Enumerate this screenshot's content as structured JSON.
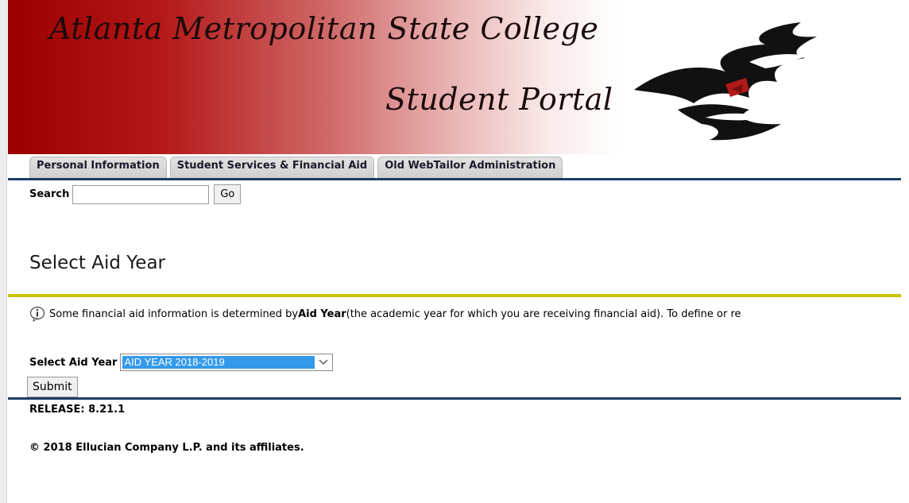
{
  "banner": {
    "title": "Atlanta Metropolitan State College",
    "subtitle": "Student Portal",
    "logo_icon": "trailblazer-logo-icon"
  },
  "tabs": [
    {
      "label": "Personal Information"
    },
    {
      "label": "Student Services & Financial Aid"
    },
    {
      "label": "Old WebTailor Administration"
    }
  ],
  "search": {
    "label": "Search",
    "value": "",
    "go_label": "Go"
  },
  "page": {
    "title": "Select Aid Year",
    "info_pre": "Some financial aid information is determined by ",
    "info_bold": "Aid Year",
    "info_post": " (the academic year for which you are receiving financial aid). To define or re",
    "info_icon": "info-icon"
  },
  "form": {
    "aid_label": "Select Aid Year",
    "aid_selected": "AID YEAR 2018-2019",
    "submit_label": "Submit"
  },
  "footer": {
    "release": "RELEASE: 8.21.1",
    "copyright": "© 2018 Ellucian Company L.P. and its affiliates."
  },
  "colors": {
    "banner_red": "#9b0000",
    "nav_rule": "#1b3e63",
    "yellow_rule": "#c8c200",
    "select_highlight": "#3399ea"
  }
}
